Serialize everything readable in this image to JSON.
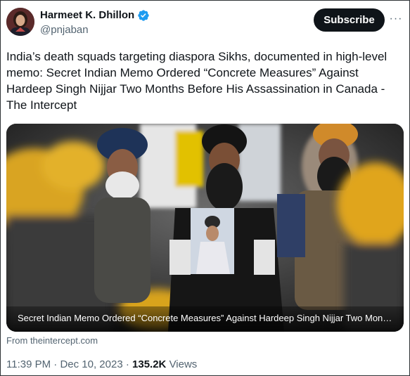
{
  "author": {
    "name": "Harmeet K. Dhillon",
    "handle": "@pnjaban"
  },
  "header": {
    "subscribe_label": "Subscribe",
    "more_label": "···"
  },
  "tweet": {
    "text": "India’s death squads targeting diaspora Sikhs, documented in high-level memo: Secret Indian Memo Ordered “Concrete Measures” Against Hardeep Singh Nijjar Two Months Before His Assassination in Canada - The Intercept"
  },
  "card": {
    "caption": "Secret Indian Memo Ordered “Concrete Measures” Against Hardeep Singh Nijjar Two Months Before His Assassination in Canada",
    "source": "From theintercept.com"
  },
  "meta": {
    "time": "11:39 PM",
    "separator": "·",
    "date": "Dec 10, 2023",
    "views_count": "135.2K",
    "views_label": "Views"
  },
  "colors": {
    "text_primary": "#0f1419",
    "text_secondary": "#536471",
    "verified_blue": "#1d9bf0",
    "subscribe_bg": "#0f1419"
  },
  "icons": {
    "verified": "verified-badge-icon",
    "more": "more-options-icon"
  }
}
